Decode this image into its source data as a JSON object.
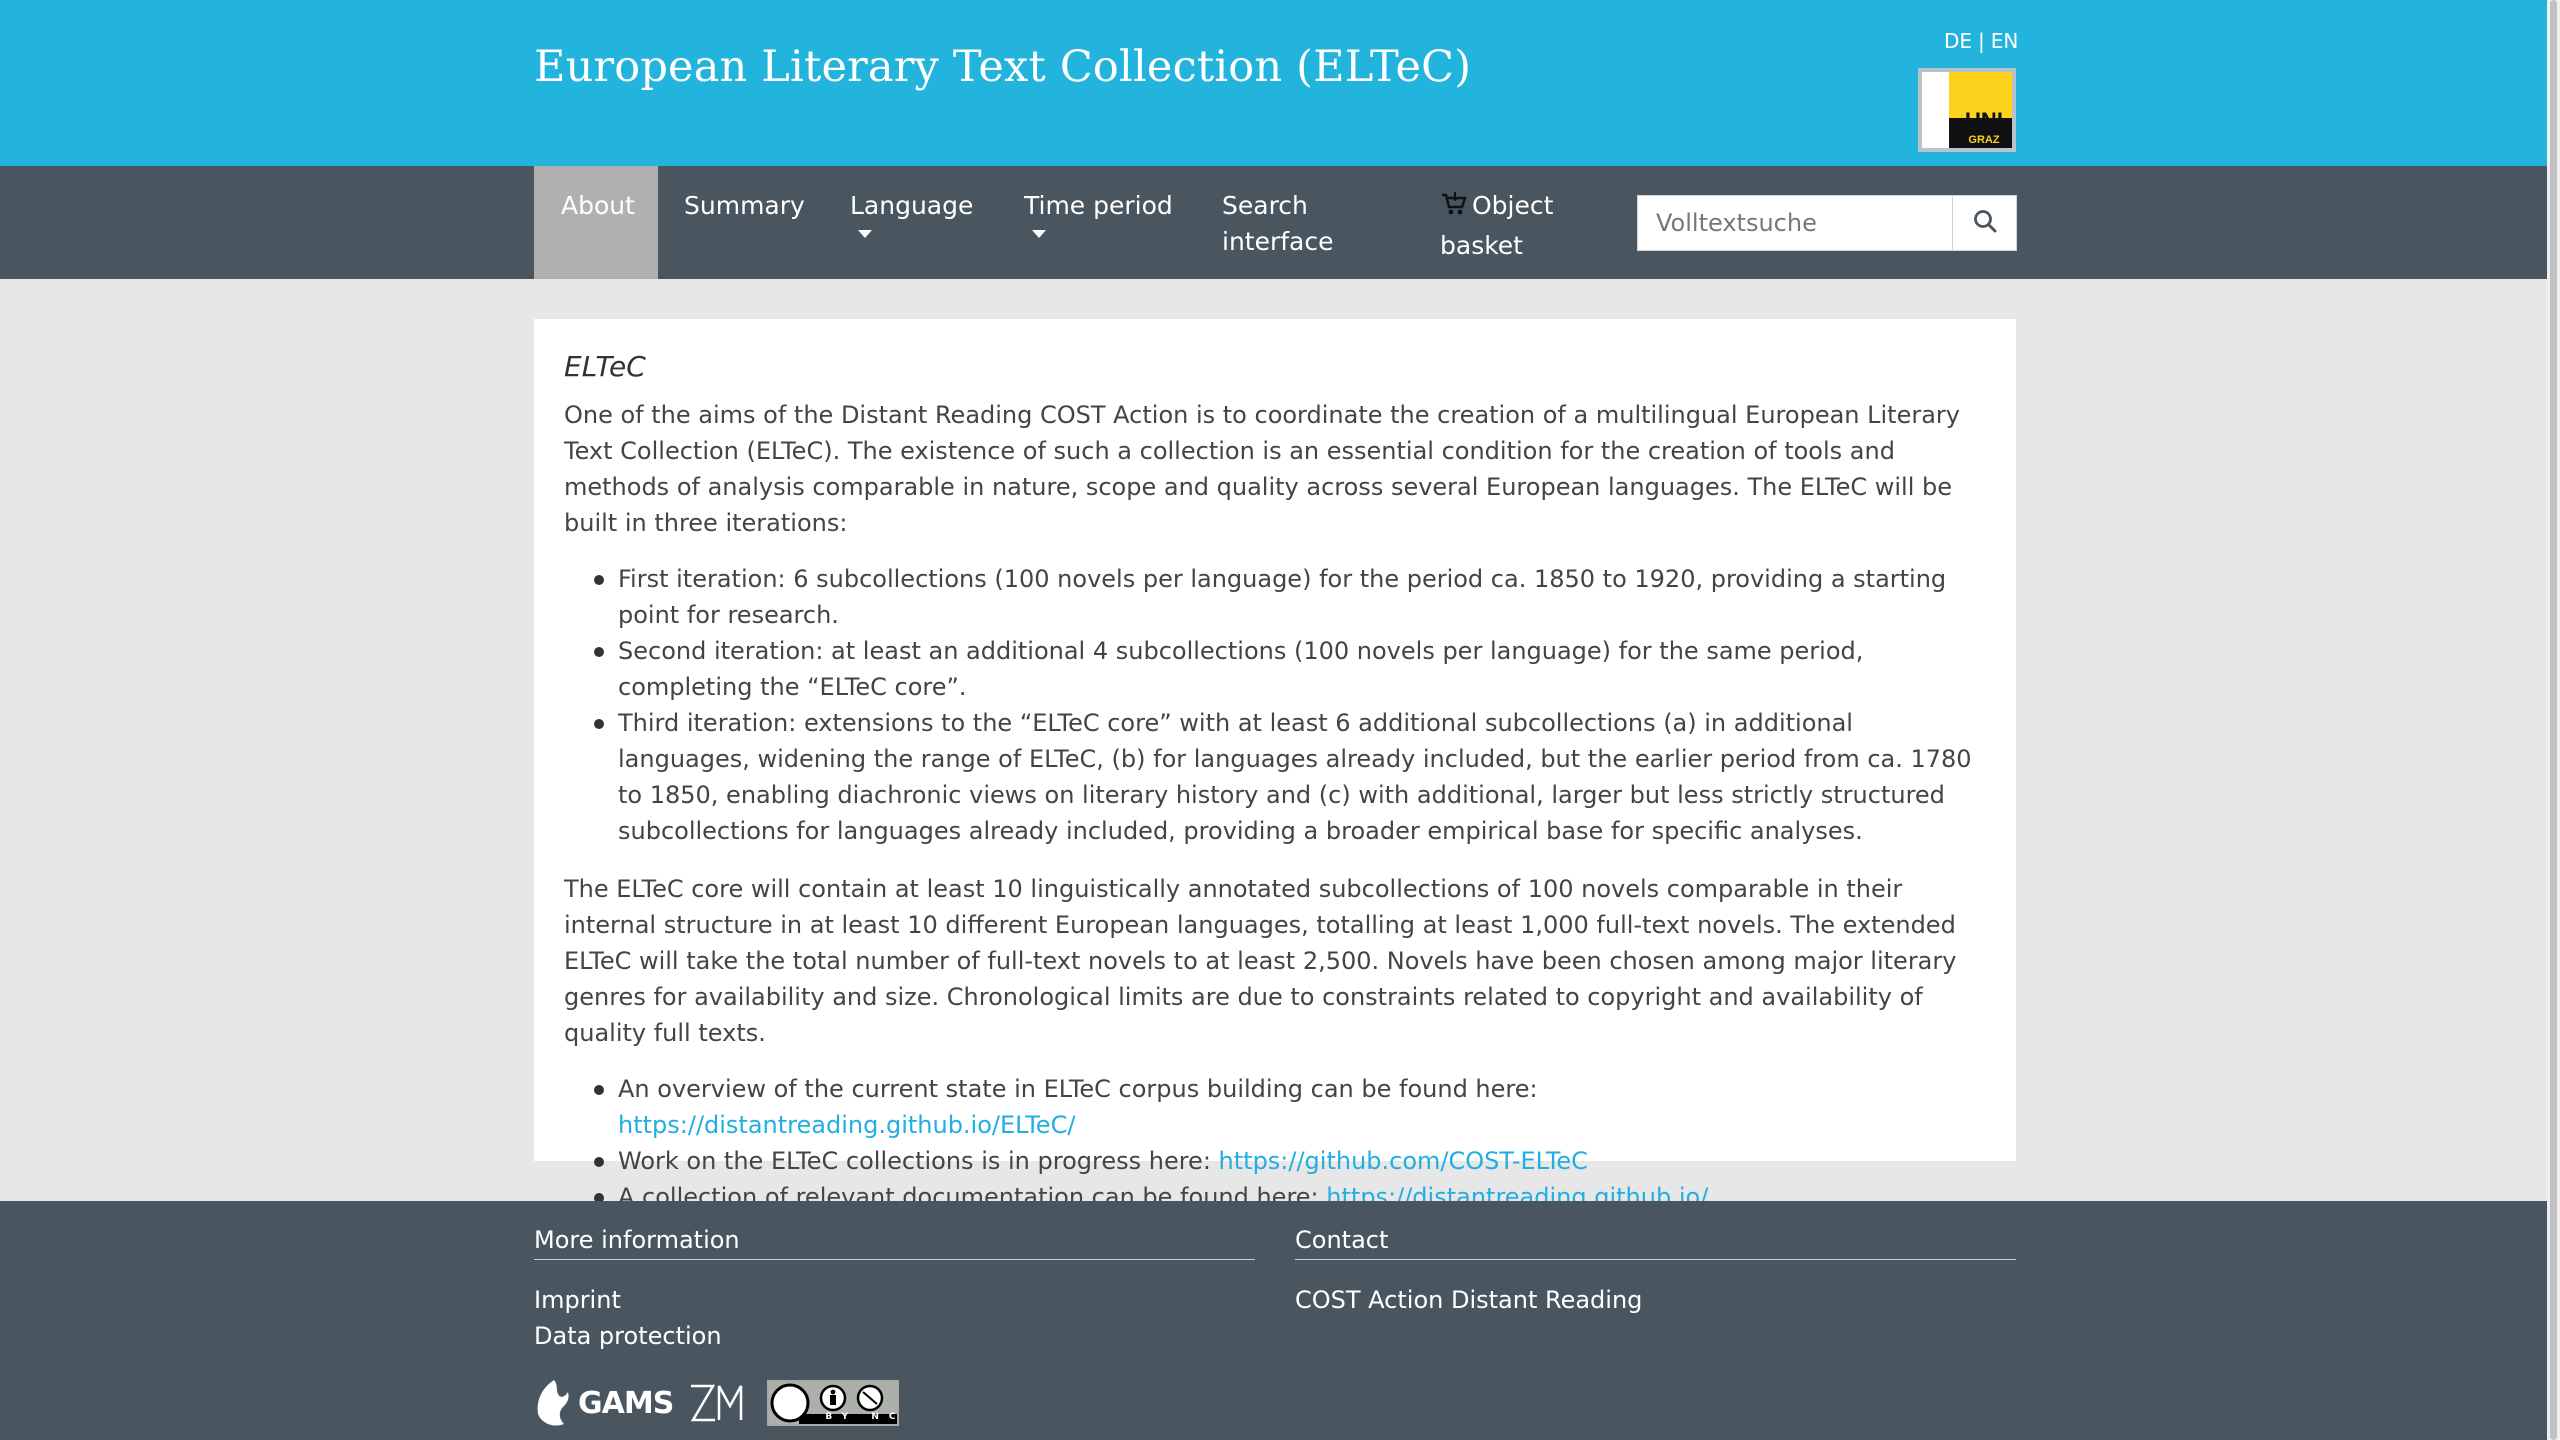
{
  "header": {
    "title": "European Literary Text Collection (ELTeC)",
    "lang_de": "DE",
    "lang_sep": "|",
    "lang_en": "EN",
    "logo_uni": "UNI",
    "logo_graz": "GRAZ"
  },
  "nav": {
    "items": [
      {
        "label": "About"
      },
      {
        "label": "Summary"
      },
      {
        "label": "Language"
      },
      {
        "label": "Time period"
      },
      {
        "label_line1": "Search",
        "label_line2": "interface"
      },
      {
        "label_line1": "Object",
        "label_line2": "basket"
      }
    ],
    "search_placeholder": "Volltextsuche"
  },
  "main": {
    "title": "ELTeC",
    "intro": "One of the aims of the Distant Reading COST Action is to coordinate the creation of a multilingual European Literary Text Collection (ELTeC). The existence of such a collection is an essential condition for the creation of tools and methods of analysis comparable in nature, scope and quality across several European languages. The ELTeC will be built in three iterations:",
    "iterations": [
      "First iteration: 6 subcollections (100 novels per language) for the period ca. 1850 to 1920, providing a starting point for research.",
      "Second iteration: at least an additional 4 subcollections (100 novels per language) for the same period, completing the “ELTeC core”.",
      "Third iteration: extensions to the “ELTeC core” with at least 6 additional subcollections (a) in additional languages, widening the range of ELTeC, (b) for languages already included, but the earlier period from ca. 1780 to 1850, enabling diachronic views on literary history and (c) with additional, larger but less strictly structured subcollections for languages already included, providing a broader empirical base for specific analyses."
    ],
    "core": "The ELTeC core will contain at least 10 linguistically annotated subcollections of 100 novels comparable in their internal structure in at least 10 different European languages, totalling at least 1,000 full-text novels. The extended ELTeC will take the total number of full-text novels to at least 2,500. Novels have been chosen among major literary genres for availability and size. Chronological limits are due to constraints related to copyright and availability of quality full texts.",
    "links": [
      {
        "text": "An overview of the current state in ELTeC corpus building can be found here: ",
        "url": "https://distantreading.github.io/ELTeC/"
      },
      {
        "text": "Work on the ELTeC collections is in progress here: ",
        "url": "https://github.com/COST-ELTeC"
      },
      {
        "text": "A collection of relevant documentation can be found here: ",
        "url": "https://distantreading.github.io/"
      }
    ]
  },
  "footer": {
    "more_info_title": "More information",
    "imprint": "Imprint",
    "data_protection": "Data protection",
    "contact_title": "Contact",
    "contact_link": "COST Action Distant Reading",
    "gams_label": "GAMS",
    "zim_label": "ZIM",
    "cc_label": "BY NC"
  },
  "colors": {
    "header_bg": "#23b4de",
    "nav_bg": "#495660",
    "nav_active_bg": "#b0b0b0",
    "link": "#22aee0"
  }
}
